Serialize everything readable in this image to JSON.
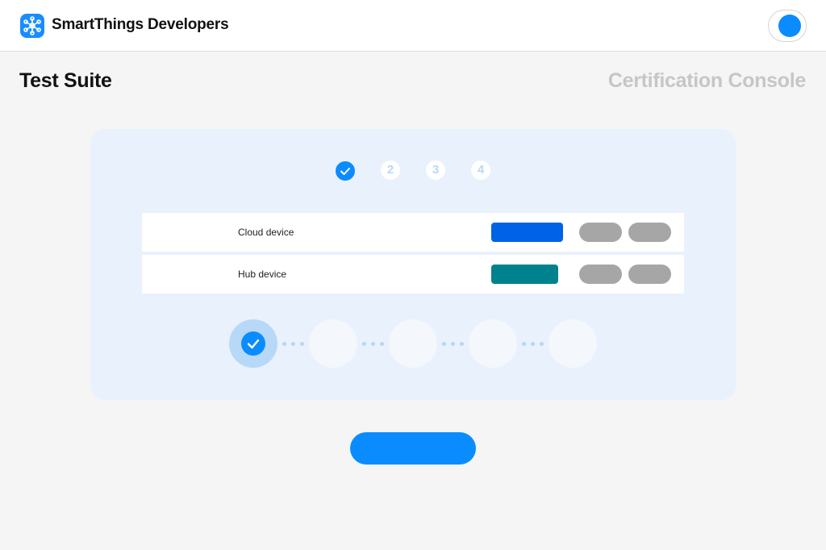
{
  "header": {
    "brand": "SmartThings Developers",
    "logo_icon": "smartthings-logo-icon",
    "profile_icon": "profile-avatar-icon"
  },
  "page": {
    "title": "Test Suite",
    "subtitle": "Certification Console"
  },
  "stepper": {
    "steps": [
      {
        "label": "",
        "state": "completed",
        "icon": "check-icon"
      },
      {
        "label": "2",
        "state": "pending"
      },
      {
        "label": "3",
        "state": "pending"
      },
      {
        "label": "4",
        "state": "pending"
      }
    ]
  },
  "devices": [
    {
      "label": "Cloud device",
      "status_color": "#0062e6"
    },
    {
      "label": "Hub device",
      "status_color": "#00828e"
    }
  ],
  "progress": {
    "completed": 1,
    "total": 5,
    "icon": "check-icon"
  },
  "cta": {
    "label": ""
  },
  "colors": {
    "accent": "#0a8cff",
    "card_background": "#e9f1fc",
    "pill_gray": "#a6a6a6",
    "muted_title": "#c6c6c6"
  }
}
